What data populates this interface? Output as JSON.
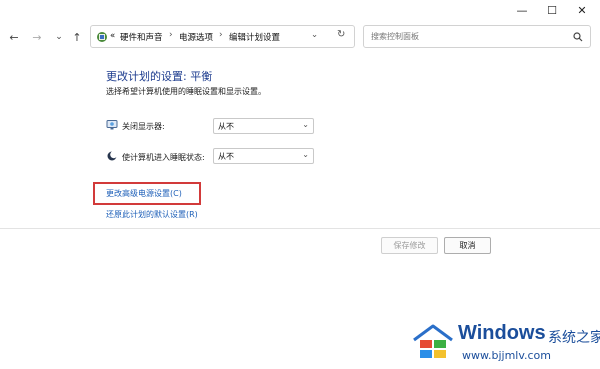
{
  "window": {
    "controls": {
      "minimize": "—",
      "maximize": "☐",
      "close": "✕"
    }
  },
  "nav": {
    "back": "←",
    "forward": "→",
    "recent": "⌄",
    "up": "↑",
    "address": {
      "overflow": "«",
      "crumbs": [
        "硬件和声音",
        "电源选项",
        "编辑计划设置"
      ],
      "separator": "›",
      "dropdown": "⌄",
      "refresh": "↻"
    },
    "search": {
      "placeholder": "搜索控制面板"
    }
  },
  "page": {
    "title": "更改计划的设置: 平衡",
    "subtitle": "选择希望计算机使用的睡眠设置和显示设置。",
    "settings": [
      {
        "label": "关闭显示器:",
        "value": "从不",
        "icon": "monitor-icon"
      },
      {
        "label": "使计算机进入睡眠状态:",
        "value": "从不",
        "icon": "moon-icon"
      }
    ],
    "links": {
      "advanced": "更改高级电源设置(C)",
      "restore": "还原此计划的默认设置(R)"
    },
    "buttons": {
      "save": "保存修改",
      "cancel": "取消"
    }
  },
  "watermark": {
    "brand": "Windows",
    "cn": "系统之家",
    "url": "www.bjjmlv.com"
  },
  "colors": {
    "title": "#1e3d8f",
    "link": "#1d5fb8",
    "highlight_box": "#d23a3a"
  }
}
